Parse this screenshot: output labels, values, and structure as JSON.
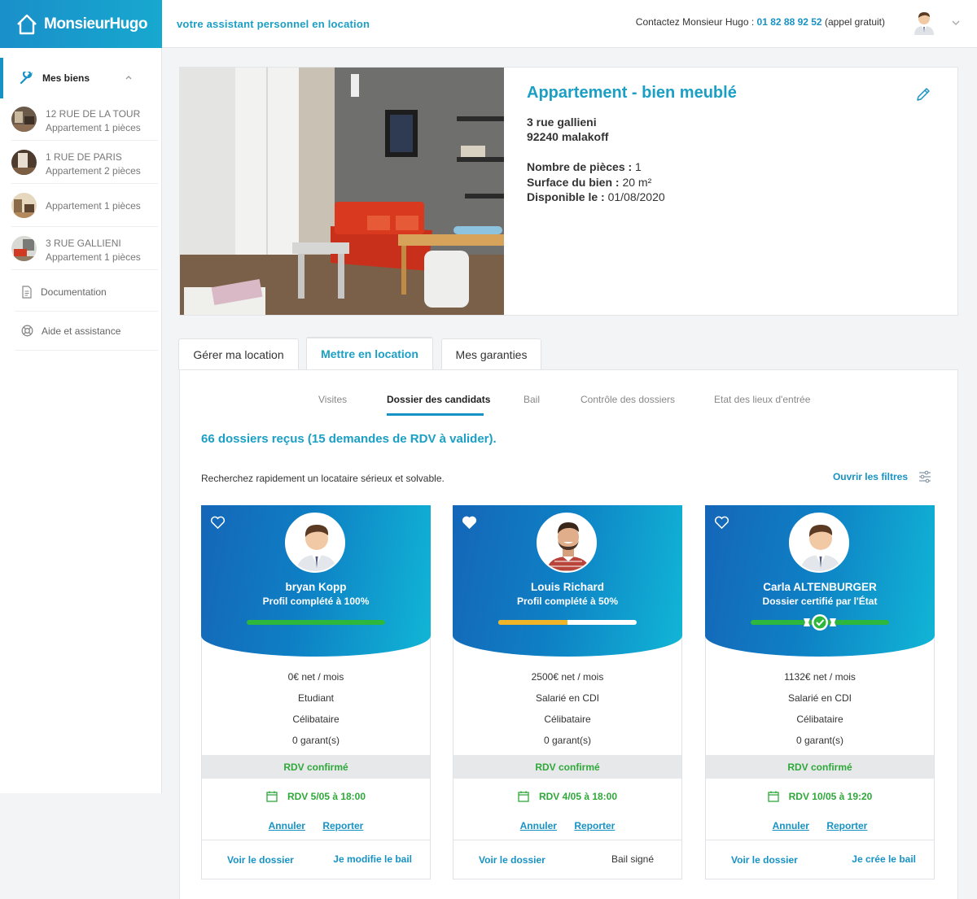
{
  "header": {
    "logo_text": "MonsieurHugo",
    "tagline": "votre assistant personnel en location",
    "contact_prefix": "Contactez Monsieur Hugo :",
    "contact_phone": "01 82 88 92 52",
    "contact_suffix": "(appel gratuit)"
  },
  "sidebar": {
    "section_label": "Mes biens",
    "properties": [
      {
        "line1": "12 RUE DE LA TOUR",
        "line2": "Appartement 1 pièces"
      },
      {
        "line1": "1 RUE DE PARIS",
        "line2": "Appartement 2 pièces"
      },
      {
        "line1": "",
        "line2": "Appartement 1 pièces"
      },
      {
        "line1": "3 RUE GALLIENI",
        "line2": "Appartement 1 pièces"
      }
    ],
    "links": [
      {
        "label": "Documentation",
        "icon": "document-icon"
      },
      {
        "label": "Aide et assistance",
        "icon": "lifebuoy-icon"
      }
    ]
  },
  "property": {
    "type": "Appartement",
    "subtitle": "- bien meublé",
    "street": "3 rue gallieni",
    "city": "92240 malakoff",
    "rooms_label": "Nombre de pièces :",
    "rooms_value": "1",
    "surface_label": "Surface du bien :",
    "surface_value": "20 m²",
    "available_label": "Disponible le :",
    "available_value": "01/08/2020"
  },
  "main_tabs": [
    {
      "label": "Gérer ma location",
      "active": false
    },
    {
      "label": "Mettre en location",
      "active": true
    },
    {
      "label": "Mes garanties",
      "active": false
    }
  ],
  "sub_tabs": [
    {
      "label": "Visites",
      "active": false
    },
    {
      "label": "Dossier des candidats",
      "active": true
    },
    {
      "label": "Bail",
      "active": false
    },
    {
      "label": "Contrôle des dossiers",
      "active": false
    },
    {
      "label": "Etat des lieux d'entrée",
      "active": false
    }
  ],
  "summary": {
    "count_text": "66 dossiers reçus (15 demandes de RDV à valider).",
    "search_hint": "Recherchez rapidement un locataire sérieux et solvable.",
    "filter_label": "Ouvrir les filtres"
  },
  "candidates": [
    {
      "name": "bryan Kopp",
      "status": "Profil complété à 100%",
      "progress": 1.0,
      "bar_color": "#2db83d",
      "certified": false,
      "favorite": false,
      "income": "0€ net / mois",
      "job": "Etudiant",
      "family": "Célibataire",
      "guarantors": "0 garant(s)",
      "rdv_status": "RDV confirmé",
      "rdv_date": "RDV 5/05 à 18:00",
      "cancel_label": "Annuler",
      "reschedule_label": "Reporter",
      "view_label": "Voir le dossier",
      "lease_label": "Je modifie le bail",
      "lease_is_link": true
    },
    {
      "name": "Louis Richard",
      "status": "Profil complété à 50%",
      "progress": 0.5,
      "bar_color": "#f0b429",
      "certified": false,
      "favorite": true,
      "income": "2500€ net / mois",
      "job": "Salarié en CDI",
      "family": "Célibataire",
      "guarantors": "0 garant(s)",
      "rdv_status": "RDV confirmé",
      "rdv_date": "RDV 4/05 à 18:00",
      "cancel_label": "Annuler",
      "reschedule_label": "Reporter",
      "view_label": "Voir le dossier",
      "lease_label": "Bail signé",
      "lease_is_link": false
    },
    {
      "name": "Carla ALTENBURGER",
      "status": "Dossier certifié par l'État",
      "progress": 1.0,
      "bar_color": "#2db83d",
      "certified": true,
      "favorite": false,
      "income": "1132€ net / mois",
      "job": "Salarié en CDI",
      "family": "Célibataire",
      "guarantors": "0 garant(s)",
      "rdv_status": "RDV confirmé",
      "rdv_date": "RDV 10/05 à 19:20",
      "cancel_label": "Annuler",
      "reschedule_label": "Reporter",
      "view_label": "Voir le dossier",
      "lease_label": "Je crée le bail",
      "lease_is_link": true
    }
  ]
}
